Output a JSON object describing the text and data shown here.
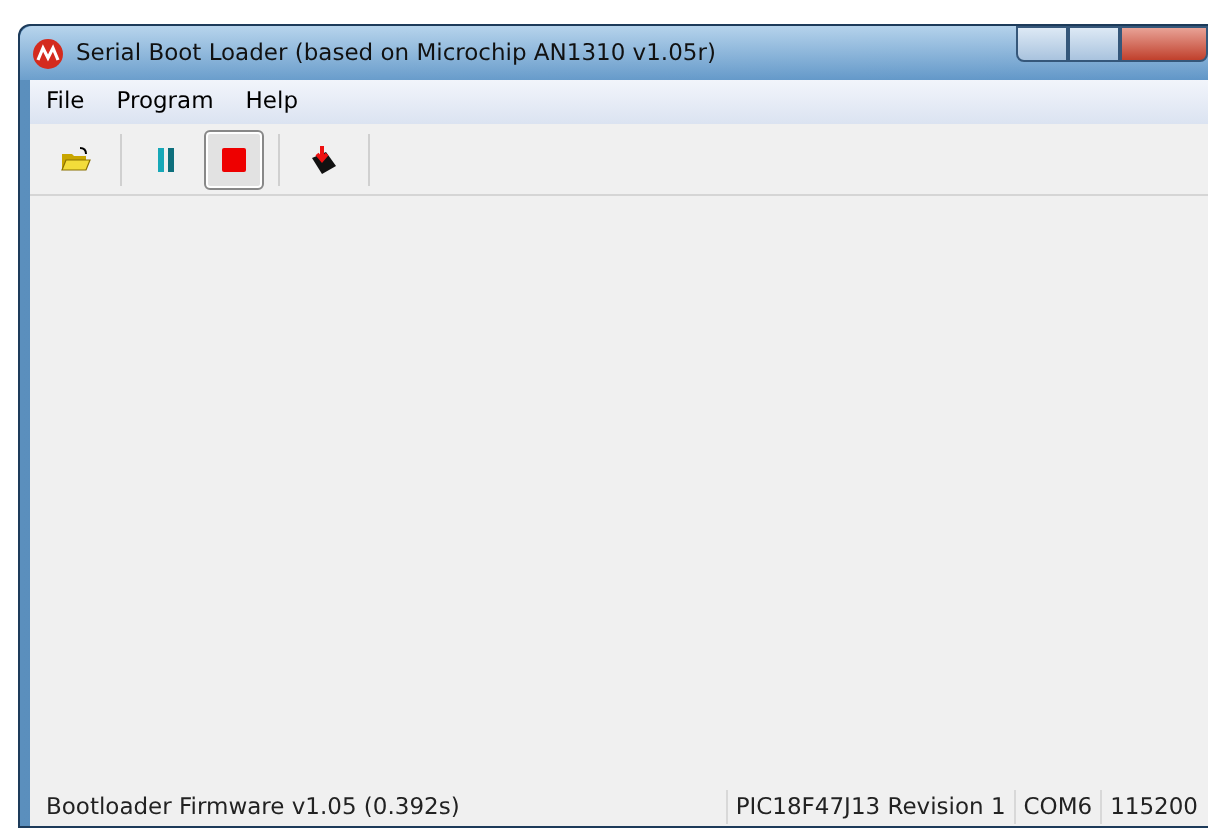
{
  "window": {
    "title": "Serial Boot Loader (based on Microchip AN1310 v1.05r)"
  },
  "menu": [
    "File",
    "Program",
    "Help"
  ],
  "toolbar": [
    {
      "kind": "open",
      "pressed": false
    },
    {
      "kind": "pause",
      "pressed": false
    },
    {
      "kind": "stop",
      "pressed": true
    },
    {
      "kind": "download",
      "pressed": false
    }
  ],
  "status_bar": {
    "message": "Bootloader Firmware v1.05 (0.392s)",
    "panels": [
      "PIC18F47J13 Revision 1",
      "COM6",
      "115200"
    ]
  }
}
